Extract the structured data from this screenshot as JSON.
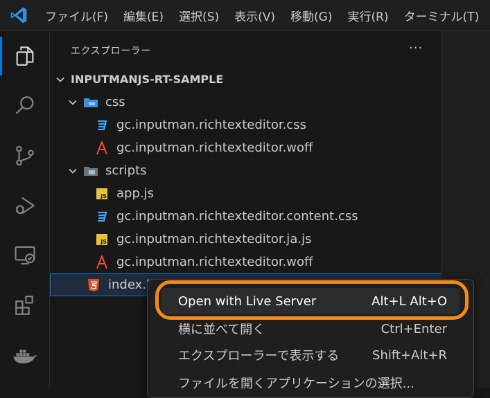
{
  "menubar": {
    "items": [
      "ファイル(F)",
      "編集(E)",
      "選択(S)",
      "表示(V)",
      "移動(G)",
      "実行(R)",
      "ターミナル(T)"
    ]
  },
  "activitybar": {
    "icons": [
      "files-icon",
      "search-icon",
      "source-control-icon",
      "run-debug-icon",
      "remote-explorer-icon",
      "extensions-icon",
      "docker-icon"
    ]
  },
  "sidebar": {
    "title": "エクスプローラー",
    "more": "···",
    "project": "INPUTMANJS-RT-SAMPLE",
    "tree": [
      {
        "label": "css",
        "type": "folder"
      },
      {
        "label": "gc.inputman.richtexteditor.css",
        "type": "css"
      },
      {
        "label": "gc.inputman.richtexteditor.woff",
        "type": "font"
      },
      {
        "label": "scripts",
        "type": "folder"
      },
      {
        "label": "app.js",
        "type": "js"
      },
      {
        "label": "gc.inputman.richtexteditor.content.css",
        "type": "css"
      },
      {
        "label": "gc.inputman.richtexteditor.ja.js",
        "type": "js"
      },
      {
        "label": "gc.inputman.richtexteditor.woff",
        "type": "font"
      },
      {
        "label": "index.h",
        "type": "html"
      }
    ]
  },
  "context_menu": {
    "items": [
      {
        "label": "Open with Live Server",
        "shortcut": "Alt+L Alt+O"
      },
      {
        "label": "横に並べて開く",
        "shortcut": "Ctrl+Enter"
      },
      {
        "label": "エクスプローラーで表示する",
        "shortcut": "Shift+Alt+R"
      },
      {
        "label": "ファイルを開くアプリケーションの選択...",
        "shortcut": ""
      }
    ]
  },
  "colors": {
    "accent": "#0078d4",
    "highlight_ring": "#f28a1d",
    "css_icon": "#42a5f5",
    "font_icon": "#f14c4c",
    "js_icon": "#e8c237",
    "html_icon": "#e44d26"
  }
}
